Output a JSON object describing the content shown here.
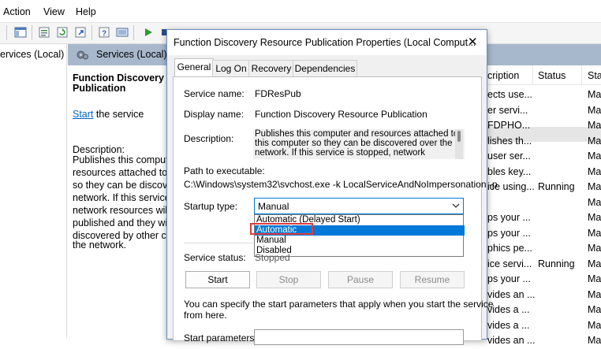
{
  "menu": {
    "action": "Action",
    "view": "View",
    "help": "Help"
  },
  "tree": {
    "label": "ervices (Local)"
  },
  "services_header": {
    "title": "Services (Local)"
  },
  "desc_pane": {
    "title_line1": "Function Discovery Re",
    "title_line2": "Publication",
    "start_link": "Start",
    "start_rest": " the service",
    "description_label": "Description:",
    "lines": [
      "Publishes this compute",
      "resources attached to t",
      "so they can be discove",
      "network.  If this service",
      "network resources will",
      "published and they wil",
      "discovered by other co",
      "the network."
    ]
  },
  "list": {
    "col_description": "cription",
    "col_status": "Status",
    "col_startup": "Sta",
    "rows": [
      {
        "desc": "ects use...",
        "status": "",
        "startup": "Ma"
      },
      {
        "desc": "er servi...",
        "status": "",
        "startup": "Ma"
      },
      {
        "desc": "FDPHO...",
        "status": "",
        "startup": "Ma"
      },
      {
        "desc": "lishes th...",
        "status": "",
        "startup": "Ma"
      },
      {
        "desc": "user ser...",
        "status": "",
        "startup": "Ma"
      },
      {
        "desc": "bles key...",
        "status": "",
        "startup": "Ma"
      },
      {
        "desc": "ice using...",
        "status": "Running",
        "startup": "Ma"
      },
      {
        "desc": "",
        "status": "",
        "startup": "Ma"
      },
      {
        "desc": "ps your ...",
        "status": "",
        "startup": "Ma"
      },
      {
        "desc": "ps your ...",
        "status": "",
        "startup": "Ma"
      },
      {
        "desc": "phics pe...",
        "status": "",
        "startup": "Ma"
      },
      {
        "desc": "ice servi...",
        "status": "Running",
        "startup": "Ma"
      },
      {
        "desc": "ps your ...",
        "status": "",
        "startup": "Ma"
      },
      {
        "desc": "vides an ...",
        "status": "",
        "startup": "Ma"
      },
      {
        "desc": "vides a ...",
        "status": "",
        "startup": "Ma"
      },
      {
        "desc": "vides a ...",
        "status": "",
        "startup": "Ma"
      },
      {
        "desc": "vides an ...",
        "status": "",
        "startup": "Ma"
      }
    ]
  },
  "dialog": {
    "title": "Function Discovery Resource Publication Properties (Local Comput...",
    "close_glyph": "✕",
    "tabs": [
      "General",
      "Log On",
      "Recovery",
      "Dependencies"
    ],
    "service_name_label": "Service name:",
    "service_name_value": "FDResPub",
    "display_name_label": "Display name:",
    "display_name_value": "Function Discovery Resource Publication",
    "description_label": "Description:",
    "description_lines": [
      "Publishes this computer and resources attached to",
      "this computer so they can be discovered over the",
      "network.  If this service is stopped, network"
    ],
    "path_label": "Path to executable:",
    "path_value": "C:\\Windows\\system32\\svchost.exe -k LocalServiceAndNoImpersonation -p",
    "startup_type_label": "Startup type:",
    "startup_type_value": "Manual",
    "startup_options": [
      "Automatic (Delayed Start)",
      "Automatic",
      "Manual",
      "Disabled"
    ],
    "highlighted_option": "Automatic",
    "service_status_label": "Service status:",
    "service_status_value": "Stopped",
    "buttons": {
      "start": "Start",
      "stop": "Stop",
      "pause": "Pause",
      "resume": "Resume"
    },
    "hint": "You can specify the start parameters that apply when you start the service",
    "hint2": "from here.",
    "start_params_label": "Start parameters:"
  },
  "colors": {
    "selection": "#0078d7",
    "callout": "#e03c3c",
    "link": "#0066cc",
    "header_strip": "#a8b8cc"
  }
}
